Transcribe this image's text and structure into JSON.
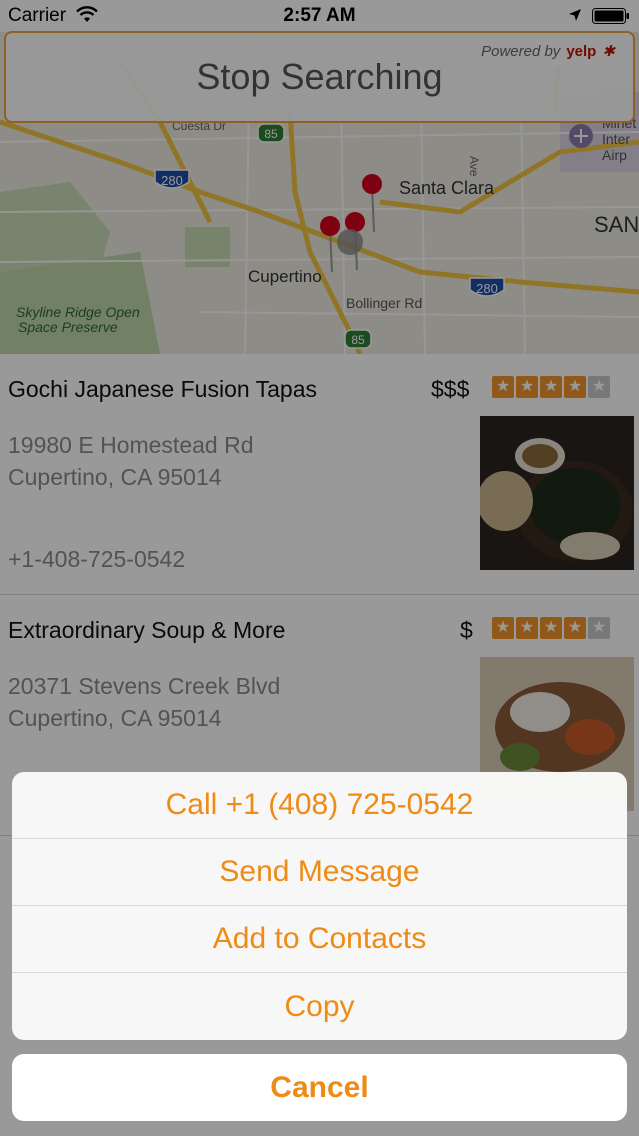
{
  "status_bar": {
    "carrier": "Carrier",
    "time": "2:57 AM",
    "icons": [
      "wifi-icon",
      "location-arrow-icon",
      "battery-icon"
    ]
  },
  "map": {
    "stop_button_label": "Stop Searching",
    "powered_by": "Powered by",
    "yelp_label": "yelp",
    "labels": {
      "santa_clara": "Santa Clara",
      "cupertino": "Cupertino",
      "bollinger": "Bollinger Rd",
      "skyline_1": "Skyline Ridge Open",
      "skyline_2": "Space Preserve",
      "cuesta": "Cuesta Dr",
      "ave": "Ave",
      "mineta_1": "Minet",
      "mineta_2": "Inter",
      "mineta_3": "Airp",
      "san": "SAN",
      "shield_280a": "280",
      "shield_280b": "280",
      "shield_85a": "85",
      "shield_85b": "85"
    }
  },
  "results": [
    {
      "name": "Gochi Japanese Fusion Tapas",
      "price": "$$$",
      "rating": 4,
      "address_line1": "19980 E Homestead Rd",
      "address_line2": "Cupertino, CA 95014",
      "phone": "+1-408-725-0542"
    },
    {
      "name": "Extraordinary Soup & More",
      "price": "$",
      "rating": 4,
      "address_line1": "20371 Stevens Creek Blvd",
      "address_line2": "Cupertino, CA 95014",
      "phone": ""
    }
  ],
  "action_sheet": {
    "call": "Call +1 (408) 725-0542",
    "message": "Send Message",
    "add_contacts": "Add to Contacts",
    "copy": "Copy",
    "cancel": "Cancel"
  },
  "colors": {
    "accent_orange": "#ef8a14",
    "star_orange": "#f0952b",
    "button_border": "#e8a33c"
  }
}
